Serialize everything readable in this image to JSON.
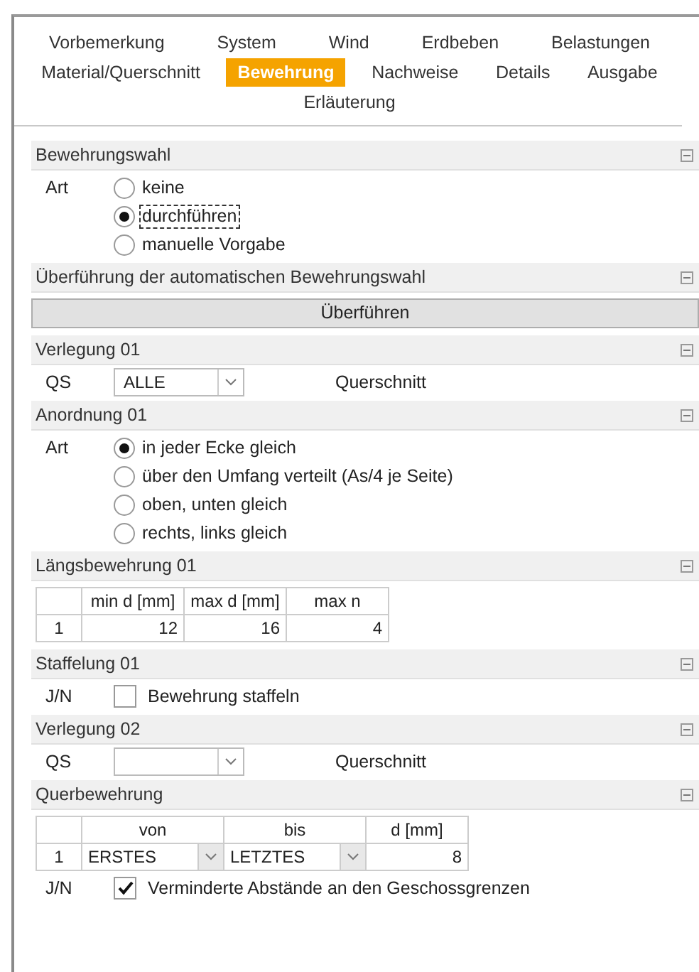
{
  "tabs": [
    {
      "label": "Vorbemerkung",
      "selected": false
    },
    {
      "label": "System",
      "selected": false
    },
    {
      "label": "Wind",
      "selected": false
    },
    {
      "label": "Erdbeben",
      "selected": false
    },
    {
      "label": "Belastungen",
      "selected": false
    },
    {
      "label": "Material/Querschnitt",
      "selected": false
    },
    {
      "label": "Bewehrung",
      "selected": true
    },
    {
      "label": "Nachweise",
      "selected": false
    },
    {
      "label": "Details",
      "selected": false
    },
    {
      "label": "Ausgabe",
      "selected": false
    },
    {
      "label": "Erläuterung",
      "selected": false
    }
  ],
  "sections": [
    {
      "title": "Bewehrungswahl",
      "expanded": true,
      "items": [
        {
          "kind": "radio",
          "label": "Art",
          "options": [
            {
              "label": "keine",
              "selected": false,
              "focused": false
            },
            {
              "label": "durchführen",
              "selected": true,
              "focused": true
            },
            {
              "label": "manuelle Vorgabe",
              "selected": false,
              "focused": false
            }
          ]
        }
      ]
    },
    {
      "title": "Überführung der automatischen Bewehrungswahl",
      "expanded": true,
      "items": [
        {
          "kind": "button",
          "text": "Überführen"
        }
      ]
    },
    {
      "title": "Verlegung 01",
      "expanded": true,
      "items": [
        {
          "kind": "select",
          "label": "QS",
          "value": "ALLE",
          "note": "Querschnitt"
        }
      ]
    },
    {
      "title": "Anordnung 01",
      "expanded": true,
      "items": [
        {
          "kind": "radio",
          "label": "Art",
          "options": [
            {
              "label": "in jeder Ecke gleich",
              "selected": true,
              "focused": false
            },
            {
              "label": "über den Umfang verteilt (As/4 je Seite)",
              "selected": false,
              "focused": false
            },
            {
              "label": "oben, unten gleich",
              "selected": false,
              "focused": false
            },
            {
              "label": "rechts, links gleich",
              "selected": false,
              "focused": false
            }
          ]
        }
      ]
    },
    {
      "title": "Längsbewehrung 01",
      "expanded": true,
      "items": [
        {
          "kind": "table",
          "columns": [
            {
              "label": "min d [mm]",
              "kind": "number"
            },
            {
              "label": "max d [mm]",
              "kind": "number"
            },
            {
              "label": "max n",
              "kind": "number"
            }
          ],
          "rows": [
            {
              "index": "1",
              "cells": [
                "12",
                "16",
                "4"
              ]
            }
          ]
        }
      ]
    },
    {
      "title": "Staffelung 01",
      "expanded": true,
      "items": [
        {
          "kind": "checkbox",
          "label": "J/N",
          "text": "Bewehrung staffeln",
          "checked": false
        }
      ]
    },
    {
      "title": "Verlegung 02",
      "expanded": true,
      "items": [
        {
          "kind": "select",
          "label": "QS",
          "note": "Querschnitt"
        }
      ]
    },
    {
      "title": "Querbewehrung",
      "expanded": true,
      "items": [
        {
          "kind": "table",
          "columns": [
            {
              "label": "von",
              "kind": "select"
            },
            {
              "label": "bis",
              "kind": "select"
            },
            {
              "label": "d [mm]",
              "kind": "number"
            }
          ],
          "rows": [
            {
              "index": "1",
              "cells": [
                "ERSTES",
                "LETZTES",
                "8"
              ]
            }
          ]
        },
        {
          "kind": "checkbox",
          "label": "J/N",
          "text": "Verminderte Abstände an den Geschossgrenzen",
          "checked": true
        }
      ]
    }
  ]
}
